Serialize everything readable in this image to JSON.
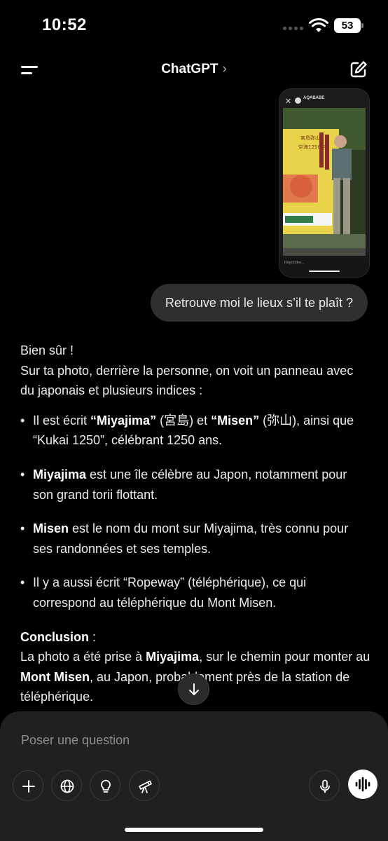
{
  "status_bar": {
    "time": "10:52",
    "battery": "53"
  },
  "header": {
    "title": "ChatGPT",
    "chevron": "›"
  },
  "attachment": {
    "account": "AQABABE",
    "reply_placeholder": "Répondre..."
  },
  "user_message": "Retrouve moi le lieux s’il te plaît ?",
  "assistant": {
    "intro_line1": "Bien sûr !",
    "intro_line2": "Sur ta photo, derrière la personne, on voit un panneau avec du japonais et plusieurs indices :",
    "bullets": [
      {
        "text_a": "Il est écrit ",
        "bold_a": "“Miyajima”",
        "text_b": " (宮島) et ",
        "bold_b": "“Misen”",
        "text_c": " (弥山), ainsi que “Kukai 1250”, célébrant 1250 ans."
      },
      {
        "bold": "Miyajima",
        "text": " est une île célèbre au Japon, notamment pour son grand torii flottant."
      },
      {
        "bold": "Misen",
        "text": " est le nom du mont sur Miyajima, très connu pour ses randonnées et ses temples."
      },
      {
        "text": "Il y a aussi écrit “Ropeway” (téléphérique), ce qui correspond au téléphérique du Mont Misen."
      }
    ],
    "conclusion_label": "Conclusion",
    "conclusion_colon": " :",
    "conclusion_text_a": "La photo a été prise à ",
    "conclusion_bold_a": "Miyajima",
    "conclusion_text_b": ", sur le chemin pour monter au ",
    "conclusion_bold_b": "Mont Misen",
    "conclusion_text_c": ", au Japon, probablement près de la station de téléphérique."
  },
  "composer": {
    "placeholder": "Poser une question",
    "tools": [
      "plus-icon",
      "globe-icon",
      "lightbulb-icon",
      "telescope-icon",
      "microphone-icon",
      "voice-waveform-icon"
    ]
  },
  "colors": {
    "background": "#000000",
    "bubble": "#2f2f2f",
    "composer": "#202020",
    "text": "#ececec"
  }
}
